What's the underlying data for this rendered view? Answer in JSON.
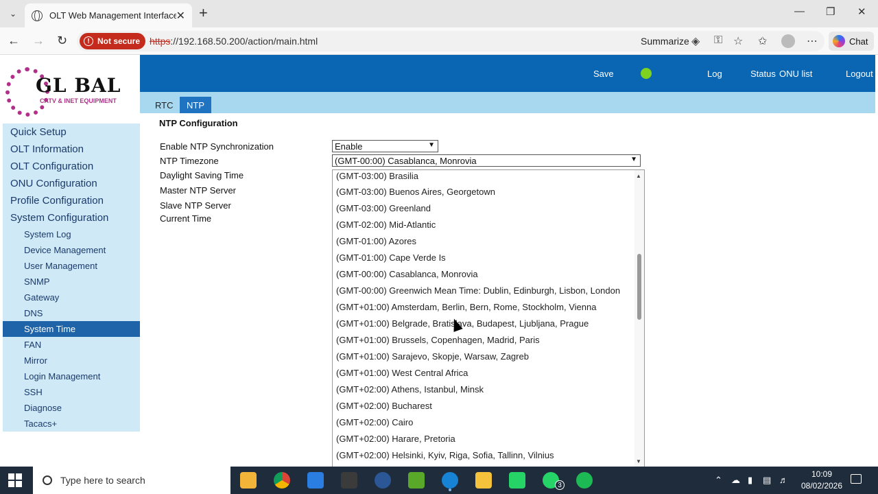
{
  "browser": {
    "tab_title": "OLT Web Management Interface",
    "not_secure": "Not secure",
    "url_scheme": "https",
    "url_rest": "://192.168.50.200/action/main.html",
    "summarize": "Summarize",
    "chat": "Chat"
  },
  "header": {
    "save": "Save",
    "log": "Log",
    "status": "Status",
    "onu_list": "ONU list",
    "logout": "Logout",
    "status_color": "#7ed321"
  },
  "logo": {
    "title": "GL   BAL",
    "subtitle": "CATV & INET EQUIPMENT"
  },
  "subtabs": [
    "RTC",
    "NTP"
  ],
  "sidebar": {
    "main": [
      "Quick Setup",
      "OLT Information",
      "OLT Configuration",
      "ONU Configuration",
      "Profile Configuration",
      "System Configuration"
    ],
    "sub": [
      "System Log",
      "Device Management",
      "User Management",
      "SNMP",
      "Gateway",
      "DNS",
      "System Time",
      "FAN",
      "Mirror",
      "Login Management",
      "SSH",
      "Diagnose",
      "Tacacs+"
    ]
  },
  "ntp": {
    "title": "NTP Configuration",
    "labels": [
      "Enable NTP Synchronization",
      "NTP Timezone",
      "Daylight Saving Time",
      "Master NTP Server",
      "Slave NTP Server",
      "Current Time"
    ],
    "enable_value": "Enable",
    "timezone_value": "(GMT-00:00) Casablanca, Monrovia"
  },
  "dropdown": {
    "items": [
      "(GMT-03:00) Brasilia",
      "(GMT-03:00) Buenos Aires, Georgetown",
      "(GMT-03:00) Greenland",
      "(GMT-02:00) Mid-Atlantic",
      "(GMT-01:00) Azores",
      "(GMT-01:00) Cape Verde Is",
      "(GMT-00:00) Casablanca, Monrovia",
      "(GMT-00:00) Greenwich Mean Time: Dublin, Edinburgh, Lisbon, London",
      "(GMT+01:00) Amsterdam, Berlin, Bern, Rome, Stockholm, Vienna",
      "(GMT+01:00) Belgrade, Bratislava, Budapest, Ljubljana, Prague",
      "(GMT+01:00) Brussels, Copenhagen, Madrid, Paris",
      "(GMT+01:00) Sarajevo, Skopje, Warsaw, Zagreb",
      "(GMT+01:00) West Central Africa",
      "(GMT+02:00) Athens, Istanbul, Minsk",
      "(GMT+02:00) Bucharest",
      "(GMT+02:00) Cairo",
      "(GMT+02:00) Harare, Pretoria",
      "(GMT+02:00) Helsinki, Kyiv, Riga, Sofia, Tallinn, Vilnius"
    ]
  },
  "taskbar": {
    "search_placeholder": "Type here to search",
    "time": "10:09",
    "date": "08/02/2026",
    "whatsapp_badge": "3"
  }
}
